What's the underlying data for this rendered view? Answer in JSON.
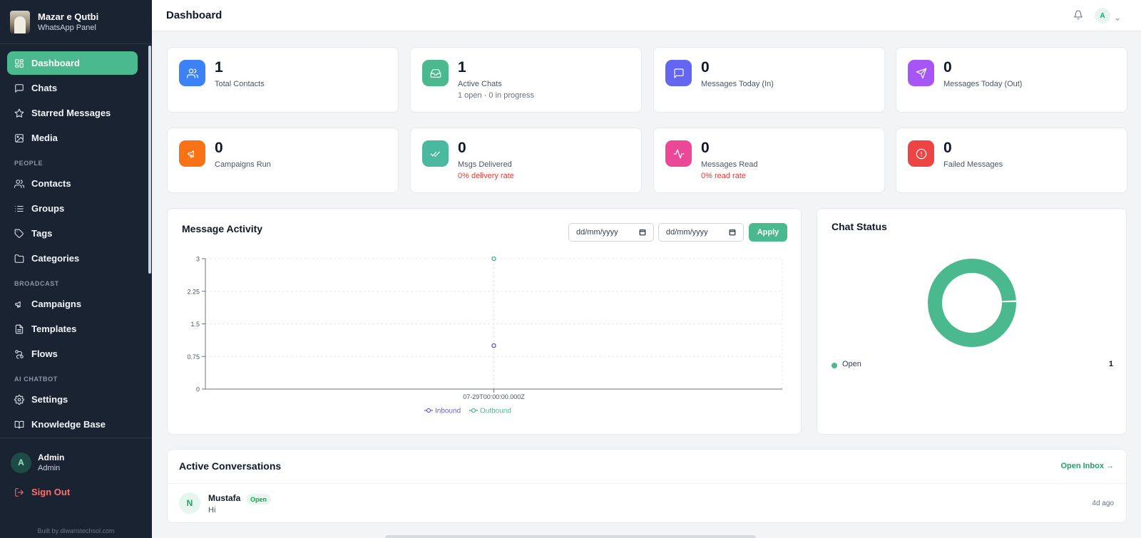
{
  "brand": {
    "name": "Mazar e Qutbi",
    "subtitle": "WhatsApp Panel"
  },
  "nav": {
    "main": [
      {
        "label": "Dashboard",
        "icon": "dashboard-icon",
        "active": true
      },
      {
        "label": "Chats",
        "icon": "chat-icon"
      },
      {
        "label": "Starred Messages",
        "icon": "star-icon"
      },
      {
        "label": "Media",
        "icon": "image-icon"
      }
    ],
    "people_title": "PEOPLE",
    "people": [
      {
        "label": "Contacts",
        "icon": "users-icon"
      },
      {
        "label": "Groups",
        "icon": "list-icon"
      },
      {
        "label": "Tags",
        "icon": "tag-icon"
      },
      {
        "label": "Categories",
        "icon": "folder-icon"
      }
    ],
    "broadcast_title": "BROADCAST",
    "broadcast": [
      {
        "label": "Campaigns",
        "icon": "megaphone-icon"
      },
      {
        "label": "Templates",
        "icon": "document-icon"
      },
      {
        "label": "Flows",
        "icon": "flow-icon"
      }
    ],
    "ai_title": "AI CHATBOT",
    "ai": [
      {
        "label": "Settings",
        "icon": "gear-icon"
      },
      {
        "label": "Knowledge Base",
        "icon": "book-icon"
      }
    ]
  },
  "user": {
    "initial": "A",
    "name": "Admin",
    "role": "Admin"
  },
  "signout_label": "Sign Out",
  "built_by": "Built by diwanstechsol.com",
  "header": {
    "title": "Dashboard",
    "avatar_initial": "A"
  },
  "stats": [
    {
      "value": "1",
      "label": "Total Contacts",
      "sub": "",
      "color": "#3b82f6",
      "icon": "users-icon"
    },
    {
      "value": "1",
      "label": "Active Chats",
      "sub": "1 open · 0 in progress",
      "color": "#4bb98e",
      "icon": "inbox-icon"
    },
    {
      "value": "0",
      "label": "Messages Today (In)",
      "sub": "",
      "color": "#6366f1",
      "icon": "chat-icon"
    },
    {
      "value": "0",
      "label": "Messages Today (Out)",
      "sub": "",
      "color": "#a855f7",
      "icon": "send-icon"
    },
    {
      "value": "0",
      "label": "Campaigns Run",
      "sub": "",
      "color": "#f97316",
      "icon": "megaphone-icon"
    },
    {
      "value": "0",
      "label": "Msgs Delivered",
      "sub": "0% delivery rate",
      "color": "#4bb9a0",
      "icon": "double-check-icon"
    },
    {
      "value": "0",
      "label": "Messages Read",
      "sub": "0% read rate",
      "color": "#ec4899",
      "icon": "activity-icon"
    },
    {
      "value": "0",
      "label": "Failed Messages",
      "sub": "",
      "color": "#ef4444",
      "icon": "alert-icon"
    }
  ],
  "activity": {
    "title": "Message Activity",
    "date_from_placeholder": "dd/mm/yyyy",
    "date_to_placeholder": "dd/mm/yyyy",
    "apply_label": "Apply"
  },
  "chart_data": {
    "type": "line",
    "x": [
      "07-29T00:00:00.000Z"
    ],
    "series": [
      {
        "name": "Inbound",
        "values": [
          1
        ],
        "color": "#6d5fd6"
      },
      {
        "name": "Outbound",
        "values": [
          3
        ],
        "color": "#4bb98e"
      }
    ],
    "yticks": [
      "0",
      "0.75",
      "1.5",
      "2.25",
      "3"
    ],
    "ylim": [
      0,
      3
    ],
    "grid": true,
    "legend": "bottom"
  },
  "chat_status": {
    "title": "Chat Status",
    "items": [
      {
        "label": "Open",
        "count": "1",
        "color": "#4bb98e"
      }
    ]
  },
  "conversations": {
    "title": "Active Conversations",
    "open_inbox_label": "Open Inbox →",
    "items": [
      {
        "initial": "N",
        "name": "Mustafa",
        "status": "Open",
        "message": "Hi",
        "time": "4d ago"
      }
    ]
  }
}
